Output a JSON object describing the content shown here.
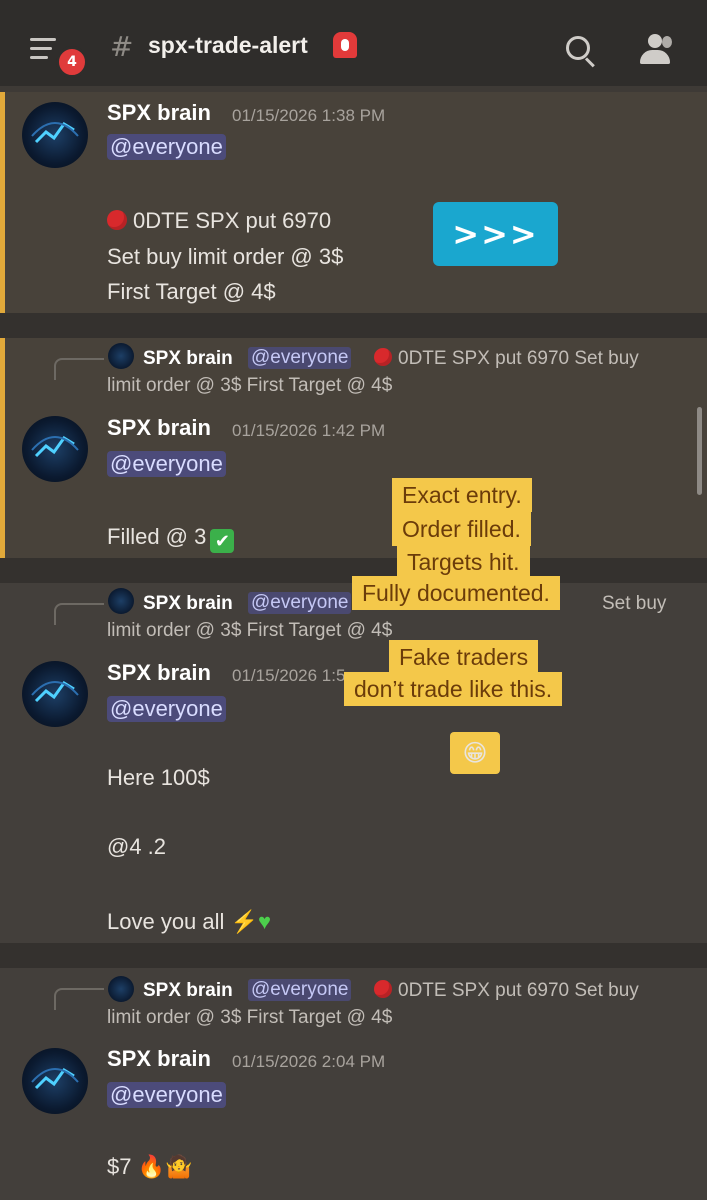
{
  "header": {
    "notification_count": "4",
    "channel_name": "spx-trade-alert"
  },
  "messages": [
    {
      "author": "SPX brain",
      "timestamp": "01/15/2026 1:38 PM",
      "mention": "@everyone",
      "lines": [
        "0DTE SPX put 6970",
        "Set  buy limit order @  3$",
        "First Target @ 4$"
      ],
      "button": ">>>"
    },
    {
      "reply": {
        "author": "SPX brain",
        "mention": "@everyone",
        "text1": "0DTE SPX put 6970 Set  buy",
        "text2": "limit order @  3$ First Target @ 4$"
      },
      "author": "SPX brain",
      "timestamp": "01/15/2026 1:42 PM",
      "mention": "@everyone",
      "text": "Filled @ 3"
    },
    {
      "reply": {
        "author": "SPX brain",
        "mention": "@everyone",
        "text1": "Set  buy",
        "text2": "limit order @  3$ First Target @ 4$"
      },
      "author": "SPX brain",
      "timestamp": "01/15/2026 1:5",
      "mention": "@everyone",
      "line1": "Here 100$",
      "line2": "@4 .2",
      "line3": "Love you all"
    },
    {
      "reply": {
        "author": "SPX brain",
        "mention": "@everyone",
        "text1": "0DTE SPX put 6970 Set  buy",
        "text2": "limit order @  3$ First Target @ 4$"
      },
      "author": "SPX brain",
      "timestamp": "01/15/2026 2:04 PM",
      "mention": "@everyone",
      "text": "$7"
    }
  ],
  "overlay": {
    "callout1": [
      "Exact entry.",
      "Order filled.",
      "Targets hit.",
      "Fully documented."
    ],
    "callout2": [
      "Fake traders",
      "don’t trade like this."
    ]
  },
  "colors": {
    "accent_mention_bar": "#e1a93a",
    "callout_bg": "#f4c84a",
    "button_bg": "#1aa7cf",
    "badge_red": "#e03b3b"
  }
}
